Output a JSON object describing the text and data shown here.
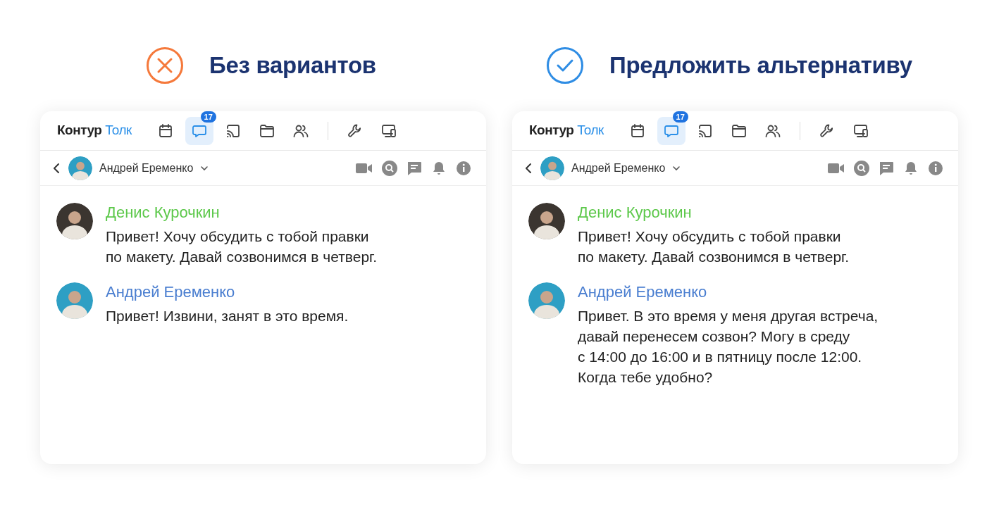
{
  "panels": [
    {
      "verdict": {
        "kind": "cross",
        "color": "#f5793b"
      },
      "title": "Без вариантов",
      "app": {
        "logo": {
          "brand": "Контур",
          "product": "Толк"
        },
        "tabs": [
          {
            "kind": "calendar",
            "selected": false
          },
          {
            "kind": "chat",
            "selected": true,
            "badge": "17"
          },
          {
            "kind": "cast",
            "selected": false
          },
          {
            "kind": "folder",
            "selected": false
          },
          {
            "kind": "people",
            "selected": false
          },
          {
            "kind": "wrench",
            "selected": false
          },
          {
            "kind": "devices",
            "selected": false
          }
        ],
        "chat_header": {
          "name": "Андрей Еременко"
        },
        "messages": [
          {
            "author": "Денис Курочкин",
            "color": "#5cc84a",
            "text": "Привет! Хочу обсудить с тобой правки\nпо макету. Давай созвонимся в четверг."
          },
          {
            "author": "Андрей Еременко",
            "color": "#4a7ed0",
            "text": "Привет! Извини, занят в это время."
          }
        ]
      }
    },
    {
      "verdict": {
        "kind": "check",
        "color": "#2f8de4"
      },
      "title": "Предложить альтернативу",
      "app": {
        "logo": {
          "brand": "Контур",
          "product": "Толк"
        },
        "tabs": [
          {
            "kind": "calendar",
            "selected": false
          },
          {
            "kind": "chat",
            "selected": true,
            "badge": "17"
          },
          {
            "kind": "cast",
            "selected": false
          },
          {
            "kind": "folder",
            "selected": false
          },
          {
            "kind": "people",
            "selected": false
          },
          {
            "kind": "wrench",
            "selected": false
          },
          {
            "kind": "devices",
            "selected": false
          }
        ],
        "chat_header": {
          "name": "Андрей Еременко"
        },
        "messages": [
          {
            "author": "Денис Курочкин",
            "color": "#5cc84a",
            "text": "Привет! Хочу обсудить с тобой правки\nпо макету. Давай созвонимся в четверг."
          },
          {
            "author": "Андрей Еременко",
            "color": "#4a7ed0",
            "text": "Привет. В это время у меня другая встреча,\nдавай перенесем созвон? Могу в среду\nс 14:00 до 16:00 и в пятницу после 12:00.\nКогда тебе удобно?"
          }
        ]
      }
    }
  ]
}
